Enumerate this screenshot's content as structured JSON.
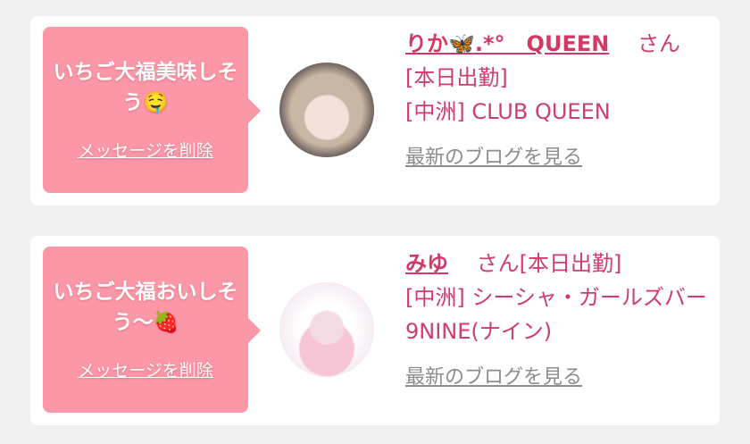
{
  "messages": [
    {
      "text": "いちご大福美味しそう",
      "emoji": "🤤",
      "delete_label": "メッセージを削除",
      "name": "りか🦋.*°　QUEEN",
      "suffix": "さん",
      "status": "[本日出勤]",
      "shop": "[中洲] CLUB QUEEN",
      "blog_label": "最新のブログを見る"
    },
    {
      "text": "いちご大福おいしそう〜",
      "emoji": "🍓",
      "delete_label": "メッセージを削除",
      "name": "みゆ",
      "suffix": "さん[本日出勤]",
      "shop": "[中洲] シーシャ・ガールズバー 9NINE(ナイン)",
      "blog_label": "最新のブログを見る"
    }
  ],
  "colors": {
    "bubble": "#fb97a6",
    "accent": "#cf3e6b",
    "link_gray": "#8c8c8c",
    "background": "#f0f0f0"
  }
}
